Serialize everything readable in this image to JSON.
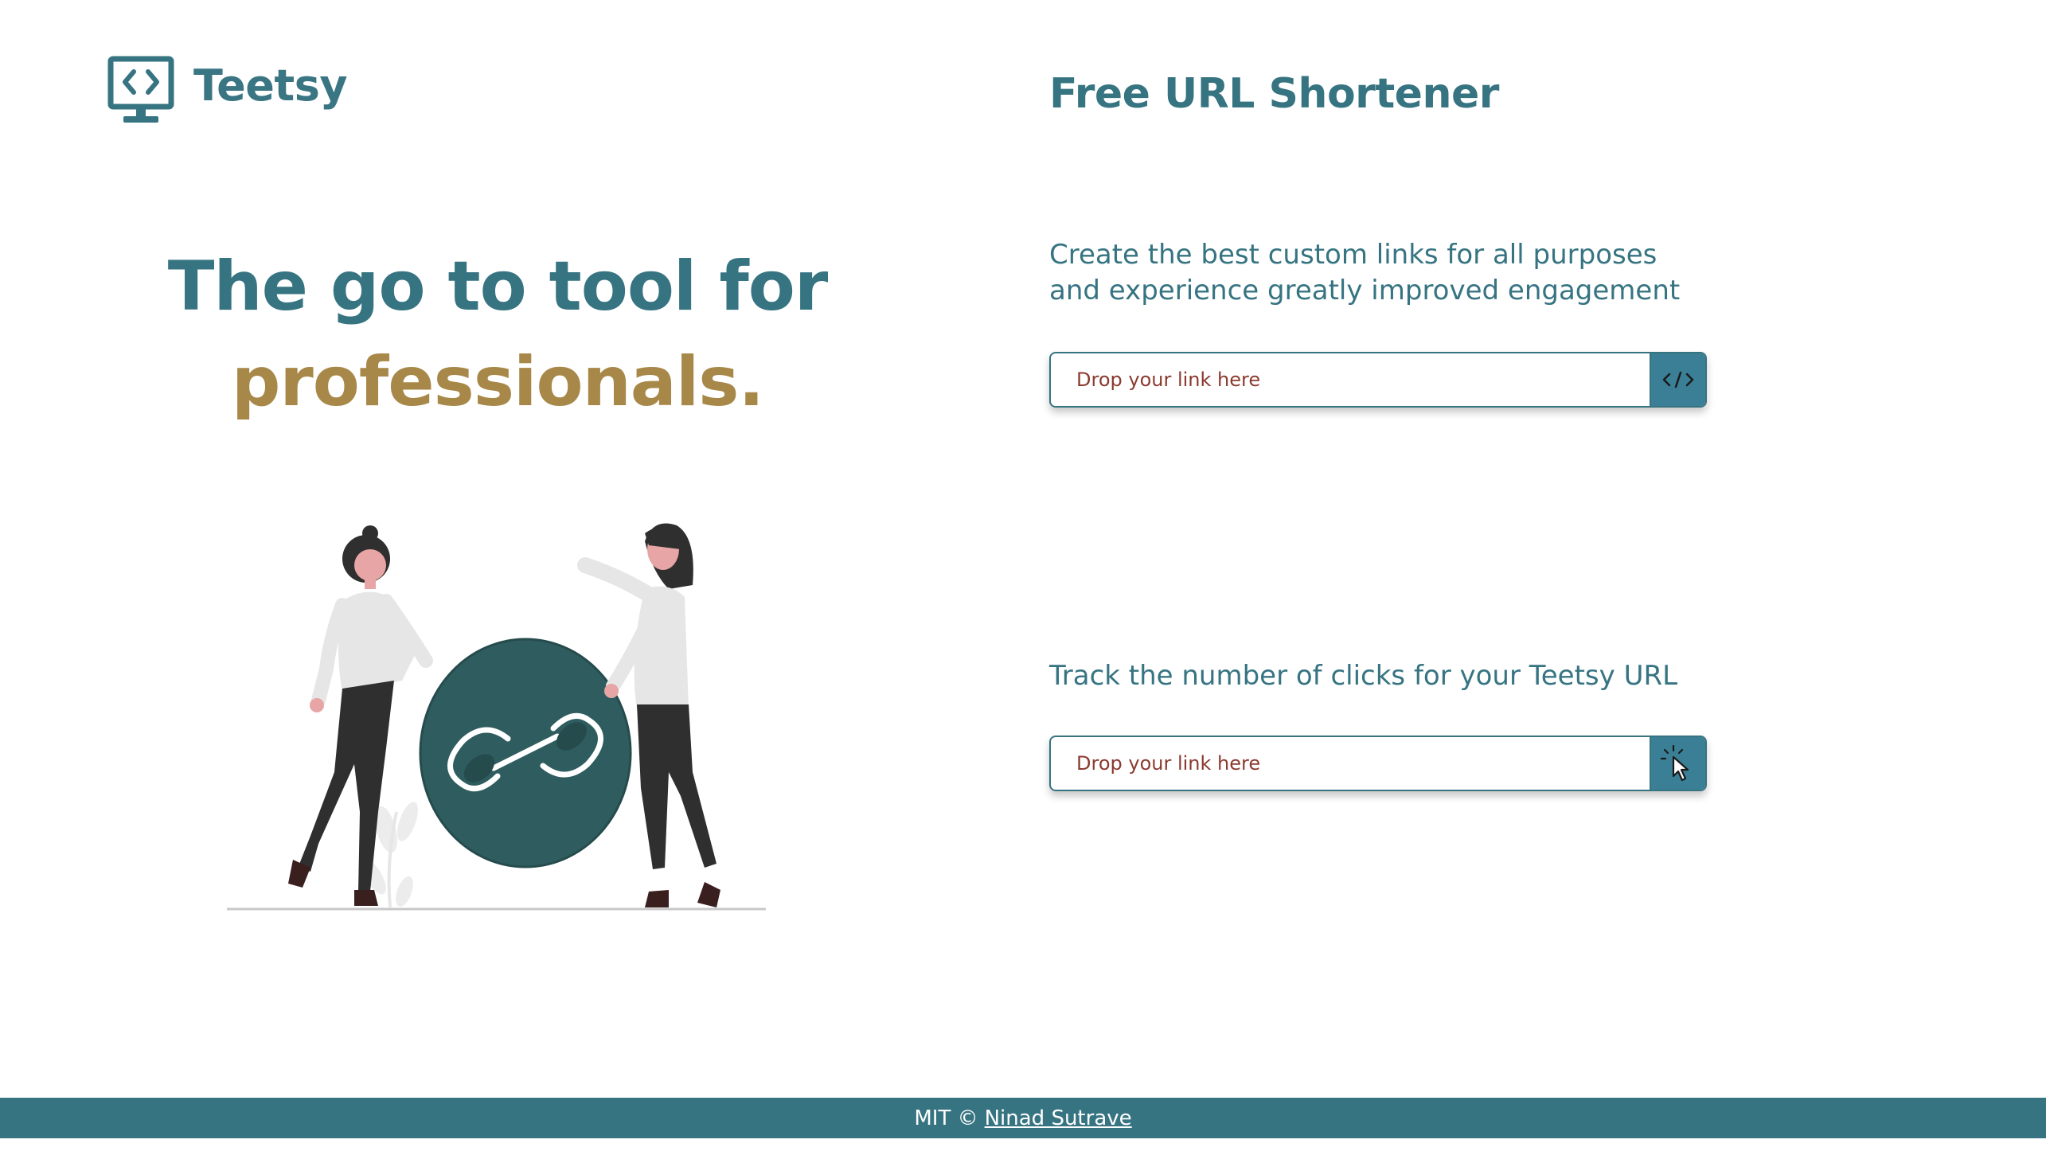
{
  "brand": {
    "name": "Teetsy",
    "icon": "code-monitor-icon"
  },
  "hero": {
    "line1": "The go to tool for",
    "line2": "professionals.",
    "illustration": "people-holding-link-illustration"
  },
  "shortener": {
    "title": "Free URL Shortener",
    "description": "Create the best custom links for all purposes and experience greatly improved engagement",
    "input_placeholder": "Drop your link here",
    "button_icon": "code-brackets-icon"
  },
  "tracker": {
    "description": "Track the number of clicks for your Teetsy URL",
    "input_placeholder": "Drop your link here",
    "button_icon": "cursor-click-icon"
  },
  "footer": {
    "prefix": "MIT ©",
    "author_link": "Ninad Sutrave"
  },
  "colors": {
    "primary": "#377482",
    "accent": "#a88849",
    "illustration_dark": "#2f5d5f",
    "button": "#3a7f95"
  }
}
